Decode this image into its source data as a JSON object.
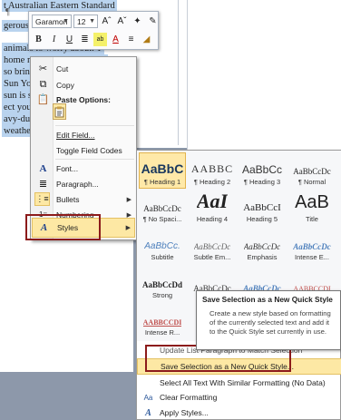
{
  "document": {
    "lines": [
      "t Australian Eastern Standard",
      "gerous su",
      "animals to worry about. T",
      "home mosquitoes and sand",
      "so bring a",
      "Sun Yo",
      "sun is st",
      "ect you",
      "avy-dut",
      "weather"
    ],
    "pilcrow": "¶"
  },
  "mini_toolbar": {
    "font": "Garamon",
    "size": "12",
    "row1_buttons": [
      "Aˆ",
      "Aˇ",
      "✦",
      "✎"
    ],
    "row2_buttons": [
      "B",
      "I",
      "U",
      "≣",
      "ab",
      "A",
      "≡",
      "◢"
    ]
  },
  "context_menu": {
    "cut": "Cut",
    "copy": "Copy",
    "paste_options": "Paste Options:",
    "edit_field": "Edit Field...",
    "toggle_codes": "Toggle Field Codes",
    "font": "Font...",
    "paragraph": "Paragraph...",
    "bullets": "Bullets",
    "numbering": "Numbering",
    "styles": "Styles"
  },
  "styles_gallery": [
    {
      "preview": "AaBbC",
      "name": "¶ Heading 1"
    },
    {
      "preview": "AABBC",
      "name": "¶ Heading 2"
    },
    {
      "preview": "AaBbCc",
      "name": "¶ Heading 3"
    },
    {
      "preview": "AaBbCcDc",
      "name": "¶ Normal"
    },
    {
      "preview": "AaBbCcDc",
      "name": "¶ No Spaci..."
    },
    {
      "preview": "AaI",
      "name": "Heading 4"
    },
    {
      "preview": "AaBbCcI",
      "name": "Heading 5"
    },
    {
      "preview": "AaB",
      "name": "Title"
    },
    {
      "preview": "AaBbCc.",
      "name": "Subtitle"
    },
    {
      "preview": "AaBbCcDc",
      "name": "Subtle Em..."
    },
    {
      "preview": "AaBbCcDc",
      "name": "Emphasis"
    },
    {
      "preview": "AaBbCcDc",
      "name": "Intense E..."
    },
    {
      "preview": "AaBbCcDd",
      "name": "Strong"
    },
    {
      "preview": "AaBbCcDc",
      "name": ""
    },
    {
      "preview": "AaBbCcDc",
      "name": ""
    },
    {
      "preview": "AABBCCDI",
      "name": ""
    },
    {
      "preview": "AABBCCDI",
      "name": "Intense R..."
    }
  ],
  "commands": {
    "update": "Update List Paragraph to Match Selection",
    "save_selection": "Save Selection as a New Quick Style...",
    "select_all": "Select All Text With Similar Formatting (No Data)",
    "clear": "Clear Formatting",
    "apply": "Apply Styles..."
  },
  "tooltip": {
    "title": "Save Selection as a New Quick Style",
    "body": "Create a new style based on formatting of the currently selected text and add it to the Quick Style set currently in use."
  },
  "colors": {
    "selection": "#b9d3ee",
    "hover": "#fde8a4",
    "highlight_frame": "#8c1b1b"
  }
}
